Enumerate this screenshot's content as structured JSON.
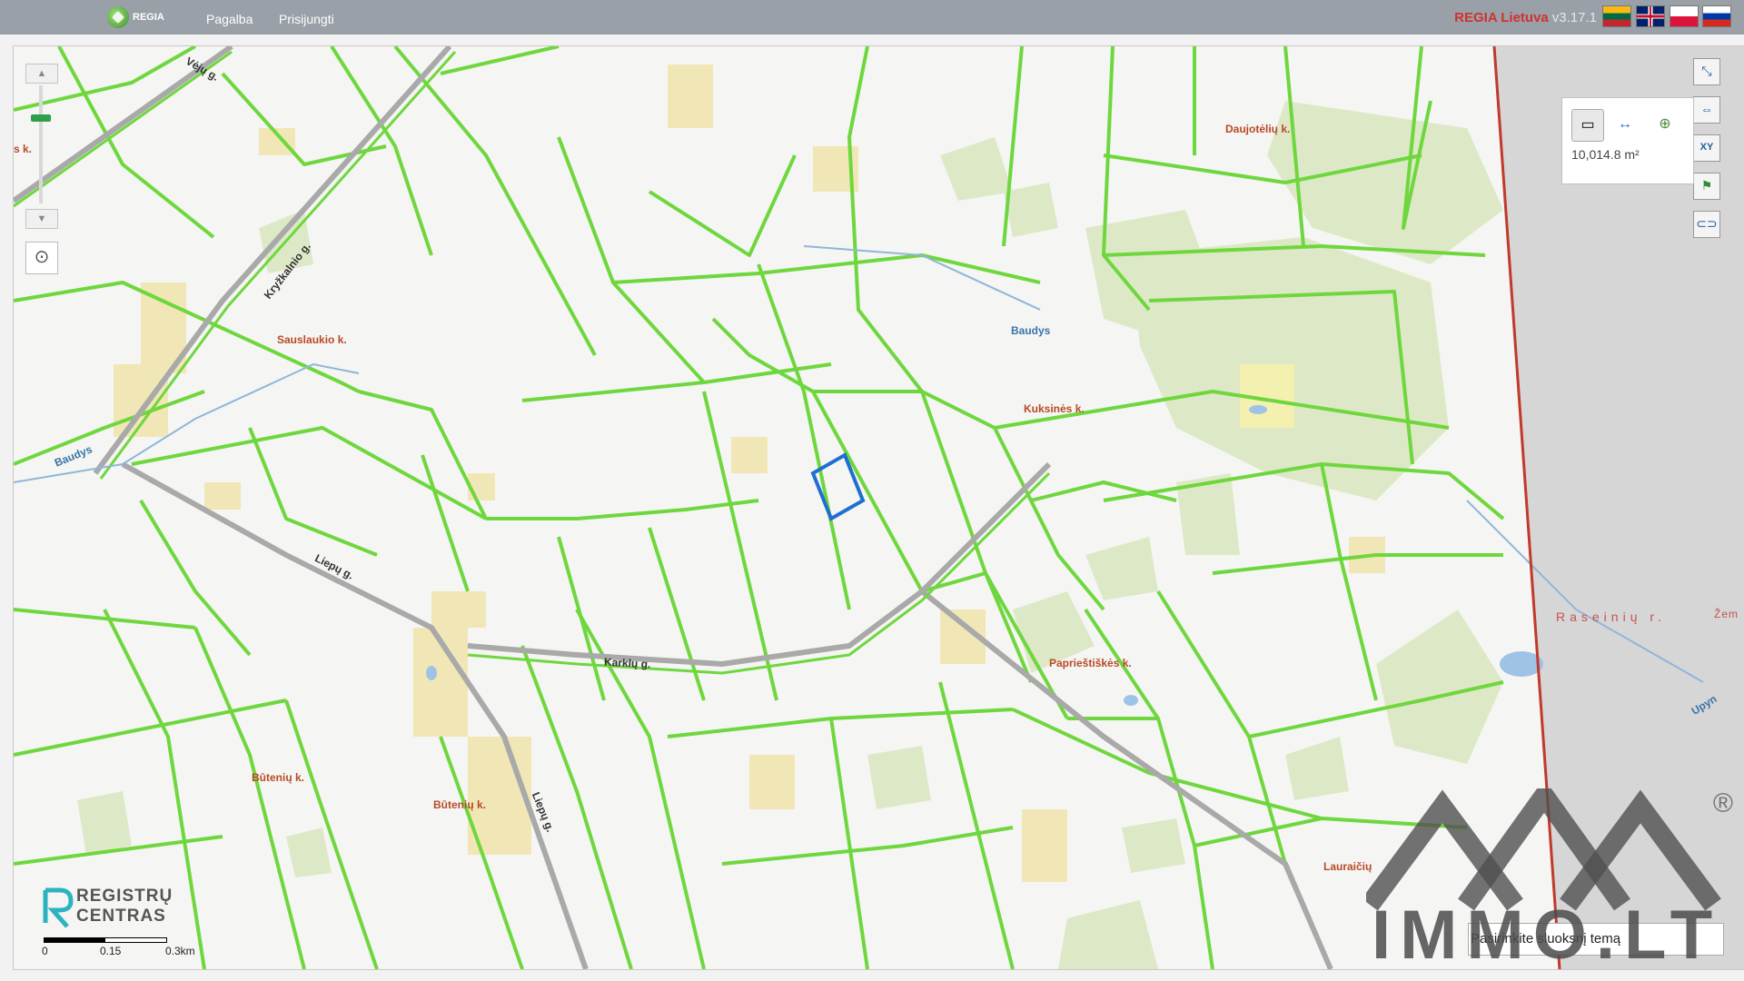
{
  "header": {
    "logo_text": "REGIA",
    "nav": [
      "Pagalba",
      "Prisijungti"
    ],
    "brand": "REGIA Lietuva",
    "version": "v3.17.1",
    "languages": [
      "lt",
      "en",
      "pl",
      "ru"
    ]
  },
  "map": {
    "villages": [
      "Sauslaukio k.",
      "Kuksinės k.",
      "Daujotėlių k.",
      "Paprieštiškės k.",
      "Būtenių k.",
      "Būtenių k.",
      "Lauraičių",
      "s k."
    ],
    "roads": [
      "Kryžkalnio g.",
      "Liepų g.",
      "Karklų g.",
      "Liepų g.",
      "Vėjų g."
    ],
    "water": [
      "Baudys",
      "Baudys",
      "Upyn"
    ],
    "region": "Raseinių r.",
    "region_partial": "Žem",
    "selected_parcel": "selected",
    "colors": {
      "parcel": "#6fd73e",
      "road": "#a9a9a9",
      "selection": "#1f6fd1",
      "boundary": "#c0392b",
      "forest": "#d8e8c0",
      "building_area": "#f1e6b4",
      "outside_area": "#d4d4d4"
    }
  },
  "controls": {
    "zoom_in": "▲",
    "zoom_out": "▼",
    "locate_icon": "target",
    "tools": [
      "fullscreen",
      "measure-distance",
      "coordinates",
      "flag",
      "link"
    ],
    "tool_labels": {
      "coordinates": "XY"
    }
  },
  "measure": {
    "area_value": "10,014.8 m²"
  },
  "footer": {
    "registry_top": "REGISTRŲ",
    "registry_bottom": "CENTRAS",
    "scale": [
      "0",
      "0.15",
      "0.3km"
    ],
    "search_placeholder": "Pasirinkite sluoksnį temą"
  },
  "watermark": {
    "text": "IMMO.LT",
    "mark": "®"
  }
}
